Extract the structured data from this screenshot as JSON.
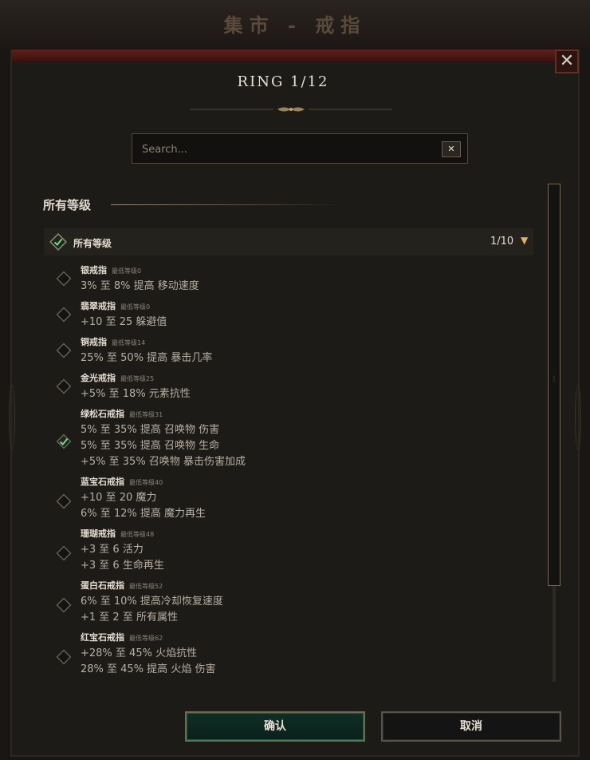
{
  "background_title": "集市 - 戒指",
  "dialog": {
    "title": "RING 1/12",
    "close_symbol": "✕"
  },
  "search": {
    "placeholder": "Search...",
    "value": "",
    "clear_symbol": "✕"
  },
  "section": {
    "title": "所有等级"
  },
  "group": {
    "label": "所有等级",
    "count": "1/10",
    "arrow": "▼",
    "checked": true
  },
  "items": [
    {
      "name": "银戒指",
      "level": "最低等级0",
      "checked": false,
      "lines": [
        "3% 至 8% 提高 移动速度"
      ]
    },
    {
      "name": "翡翠戒指",
      "level": "最低等级0",
      "checked": false,
      "lines": [
        "+10 至 25 躲避值"
      ]
    },
    {
      "name": "铜戒指",
      "level": "最低等级14",
      "checked": false,
      "lines": [
        "25% 至 50% 提高 暴击几率"
      ]
    },
    {
      "name": "金光戒指",
      "level": "最低等级25",
      "checked": false,
      "lines": [
        "+5% 至 18% 元素抗性"
      ]
    },
    {
      "name": "绿松石戒指",
      "level": "最低等级31",
      "checked": true,
      "lines": [
        "5% 至 35% 提高 召唤物 伤害",
        "5% 至 35% 提高 召唤物 生命",
        "+5% 至 35% 召唤物 暴击伤害加成"
      ]
    },
    {
      "name": "蓝宝石戒指",
      "level": "最低等级40",
      "checked": false,
      "lines": [
        "+10 至 20 魔力",
        "6% 至 12% 提高 魔力再生"
      ]
    },
    {
      "name": "珊瑚戒指",
      "level": "最低等级48",
      "checked": false,
      "lines": [
        "+3 至 6 活力",
        "+3 至 6 生命再生"
      ]
    },
    {
      "name": "蛋白石戒指",
      "level": "最低等级52",
      "checked": false,
      "lines": [
        "6% 至 10% 提高冷却恢复速度",
        "+1 至 2 至 所有属性"
      ]
    },
    {
      "name": "红宝石戒指",
      "level": "最低等级62",
      "checked": false,
      "lines": [
        "+28% 至 45% 火焰抗性",
        "28% 至 45% 提高 火焰 伤害"
      ]
    }
  ],
  "buttons": {
    "confirm": "确认",
    "cancel": "取消"
  },
  "colors": {
    "accent_gold": "#e2b44a",
    "check_green": "#7fd08a",
    "confirm_bg": "#0f2e26",
    "dialog_bg": "#1c1b18"
  }
}
